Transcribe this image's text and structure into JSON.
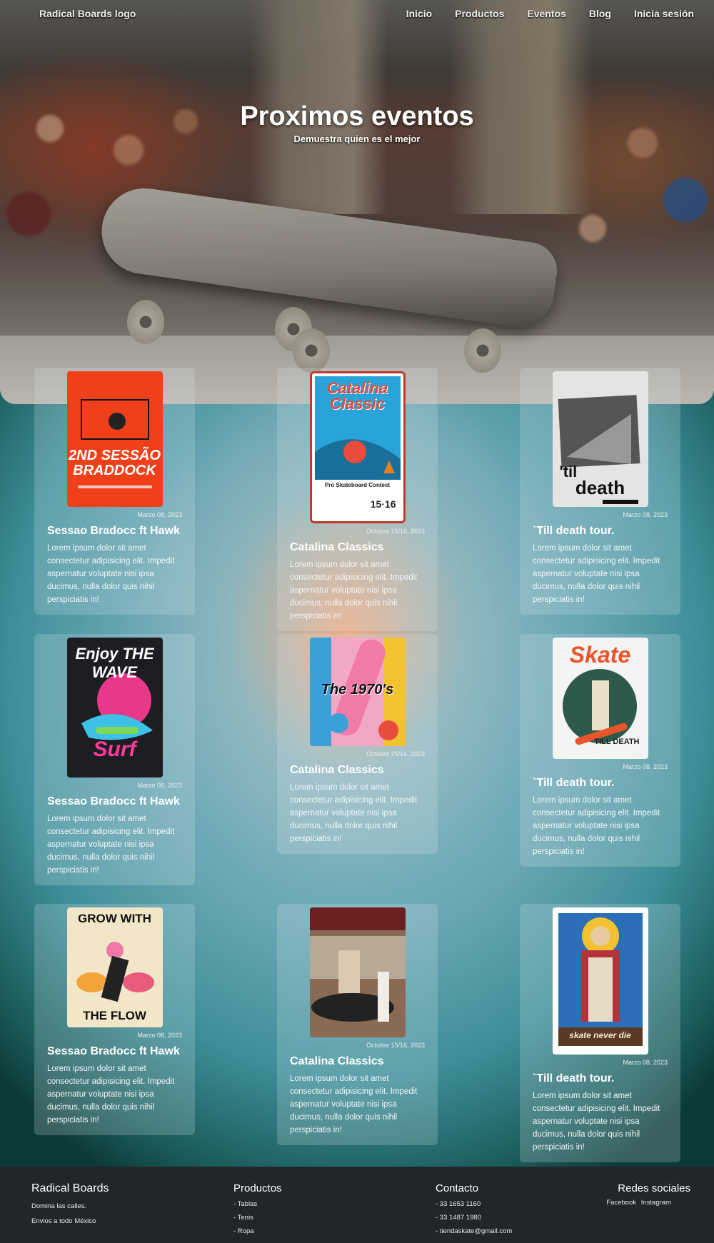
{
  "nav": {
    "logo": "Radical Boards logo",
    "items": [
      "Inicio",
      "Productos",
      "Eventos",
      "Blog",
      "Inicia sesión"
    ]
  },
  "hero": {
    "title": "Proximos eventos",
    "subtitle": "Demuestra quien es el mejor"
  },
  "cards": [
    {
      "date": "Marzo 08, 2023",
      "title": "Sessao Bradocc ft Hawk",
      "body": "Lorem ipsum dolor sit amet consectetur adipisicing elit. Impedit aspernatur voluptate nisi ipsa ducimus, nulla dolor quis nihil perspiciatis in!",
      "poster": {
        "line1": "2ND SESSÃO",
        "line2": "BRADDOCK"
      }
    },
    {
      "date": "Octubre 15/16, 2023",
      "title": "Catalina Classics",
      "body": "Lorem ipsum dolor sit amet consectetur adipisicing elit. Impedit aspernatur voluptate nisi ipsa ducimus, nulla dolor quis nihil perspiciatis in!",
      "poster": {
        "line1": "Catalina Classic",
        "line2": "Pro Skateboard Contest",
        "line3": "15·16"
      }
    },
    {
      "date": "Marzo 08, 2023",
      "title": "`Till death tour.",
      "body": "Lorem ipsum dolor sit amet consectetur adipisicing elit. Impedit aspernatur voluptate nisi ipsa ducimus, nulla dolor quis nihil perspiciatis in!",
      "poster": {
        "line1": "'til",
        "line2": "death"
      }
    },
    {
      "date": "Marzo 08, 2023",
      "title": "Sessao Bradocc ft Hawk",
      "body": "Lorem ipsum dolor sit amet consectetur adipisicing elit. Impedit aspernatur voluptate nisi ipsa ducimus, nulla dolor quis nihil perspiciatis in!",
      "poster": {
        "line1": "Enjoy THE WAVE",
        "line2": "Surf"
      }
    },
    {
      "date": "Octubre 15/16, 2023",
      "title": "Catalina Classics",
      "body": "Lorem ipsum dolor sit amet consectetur adipisicing elit. Impedit aspernatur voluptate nisi ipsa ducimus, nulla dolor quis nihil perspiciatis in!",
      "poster": {
        "line1": "The 1970's"
      }
    },
    {
      "date": "Marzo 08, 2023",
      "title": "`Till death tour.",
      "body": "Lorem ipsum dolor sit amet consectetur adipisicing elit. Impedit aspernatur voluptate nisi ipsa ducimus, nulla dolor quis nihil perspiciatis in!",
      "poster": {
        "line1": "Skate",
        "line2": "TILL DEATH"
      }
    },
    {
      "date": "Marzo 08, 2023",
      "title": "Sessao Bradocc ft Hawk",
      "body": "Lorem ipsum dolor sit amet consectetur adipisicing elit. Impedit aspernatur voluptate nisi ipsa ducimus, nulla dolor quis nihil perspiciatis in!",
      "poster": {
        "line1": "GROW WITH",
        "line2": "THE FLOW"
      }
    },
    {
      "date": "Octubre 15/16, 2023",
      "title": "Catalina Classics",
      "body": "Lorem ipsum dolor sit amet consectetur adipisicing elit. Impedit aspernatur voluptate nisi ipsa ducimus, nulla dolor quis nihil perspiciatis in!",
      "poster": {}
    },
    {
      "date": "Marzo 08, 2023",
      "title": "`Till death tour.",
      "body": "Lorem ipsum dolor sit amet consectetur adipisicing elit. Impedit aspernatur voluptate nisi ipsa ducimus, nulla dolor quis nihil perspiciatis in!",
      "poster": {
        "line1": "skate never die"
      }
    }
  ],
  "footer": {
    "brand": {
      "title": "Radical Boards",
      "lines": [
        "Domina las calles.",
        "Envios a todo México"
      ]
    },
    "products": {
      "title": "Productos",
      "items": [
        "- Tablas",
        "- Tenis",
        "- Ropa"
      ]
    },
    "contact": {
      "title": "Contacto",
      "items": [
        "- 33 1653 1160",
        "- 33 1487 1980",
        "- tiendaskate@gmail.com"
      ]
    },
    "social": {
      "title": "Redes sociales",
      "items": [
        "Facebook",
        "Instagram"
      ]
    }
  }
}
